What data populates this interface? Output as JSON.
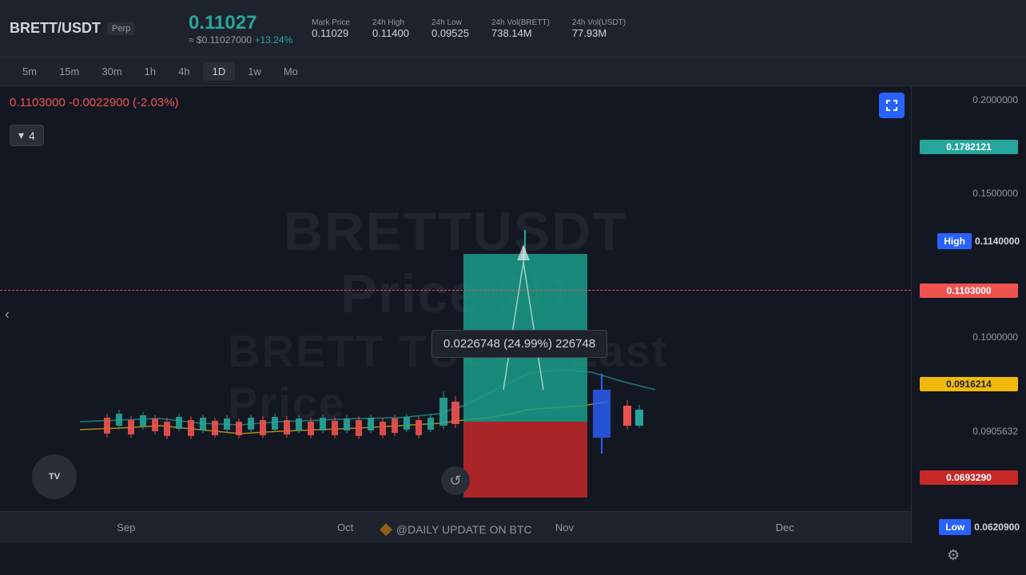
{
  "header": {
    "pair": "BRETT/USDT",
    "type": "Perp",
    "price_big": "0.11027",
    "price_usd": "≈ $0.11027000",
    "price_change": "+13.24%",
    "mark_price_label": "Mark Price",
    "mark_price_value": "0.11029",
    "high_24h_label": "24h High",
    "high_24h_value": "0.11400",
    "low_24h_label": "24h Low",
    "low_24h_value": "0.09525",
    "vol_brett_label": "24h Vol(BRETT)",
    "vol_brett_value": "738.14M",
    "vol_usdt_label": "24h Vol(USDT)",
    "vol_usdt_value": "77.93M"
  },
  "timeframes": {
    "items": [
      "5m",
      "15m",
      "30m",
      "1h",
      "4h",
      "1D",
      "1w",
      "Mo"
    ],
    "active": "1D"
  },
  "chart": {
    "price_info": "0.1103000  -0.0022900 (-2.03%)",
    "legend_value": "4",
    "tooltip": "0.0226748 (24.99%) 226748",
    "watermark_top": "BRETTUSDT",
    "watermark_middle1": "Price",
    "watermark_middle2": "1D",
    "watermark_bottom1": "BRETT",
    "watermark_bottom2": "TUSDT Last Price",
    "reset_icon": "↺"
  },
  "price_scale": {
    "levels": [
      {
        "value": "0.2000000",
        "type": "plain"
      },
      {
        "value": "0.1782121",
        "type": "teal"
      },
      {
        "value": "0.1500000",
        "type": "plain"
      },
      {
        "value": "0.1140000",
        "type": "high",
        "label": "High"
      },
      {
        "value": "0.1103000",
        "type": "red"
      },
      {
        "value": "0.1000000",
        "type": "plain"
      },
      {
        "value": "0.0916214",
        "type": "yellow"
      },
      {
        "value": "0.0905632",
        "type": "plain"
      },
      {
        "value": "0.0693290",
        "type": "red2"
      },
      {
        "value": "0.0620900",
        "type": "low",
        "label": "Low"
      }
    ]
  },
  "bottom_months": {
    "labels": [
      "Sep",
      "Oct",
      "Nov",
      "Dec"
    ]
  },
  "footer": {
    "daily_update": "🔶 @DAILY UPDATE ON BTC"
  }
}
